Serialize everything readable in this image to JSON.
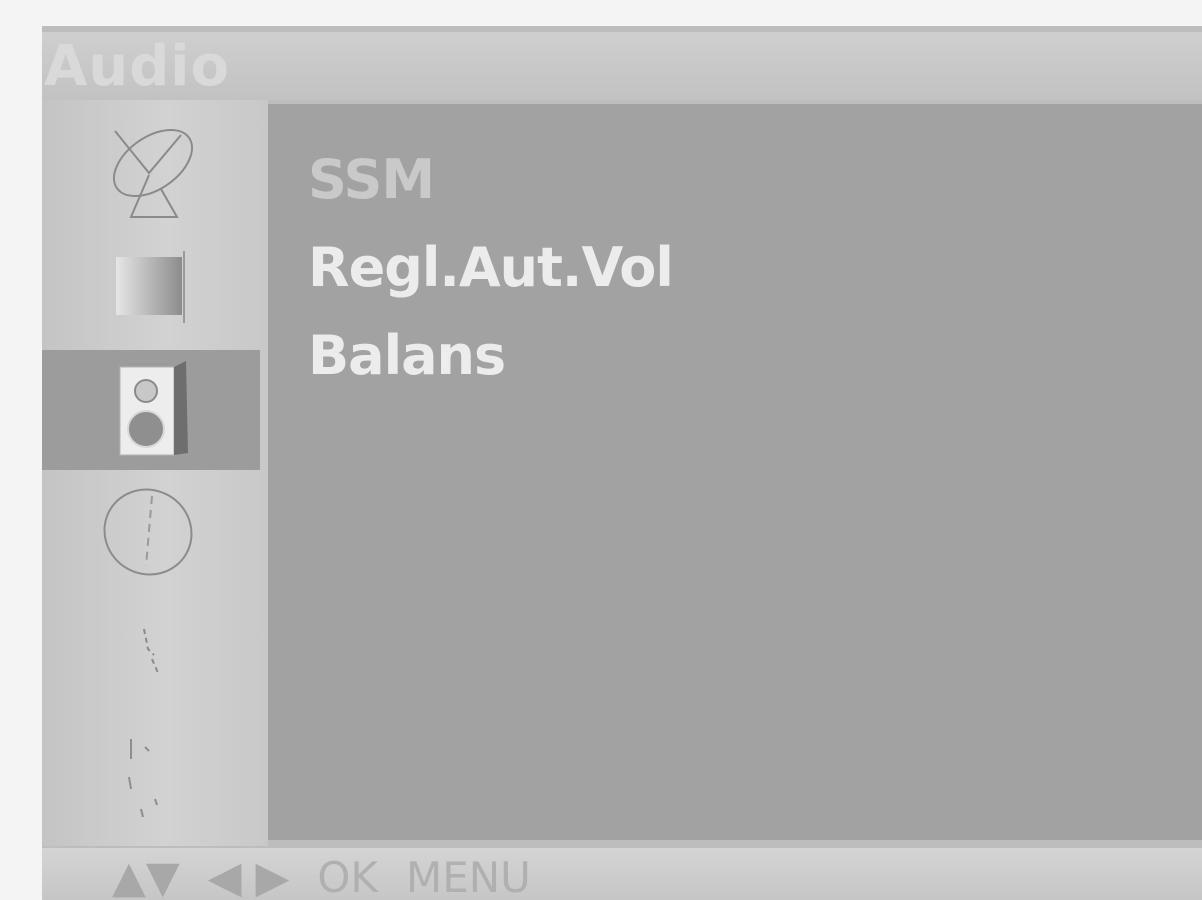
{
  "osd": {
    "title": "Audio",
    "sidebar_icons": [
      {
        "name": "satellite-dish-icon",
        "selected": false
      },
      {
        "name": "picture-icon",
        "selected": false
      },
      {
        "name": "speaker-icon",
        "selected": true
      },
      {
        "name": "clock-icon",
        "selected": false
      },
      {
        "name": "special-settings-icon",
        "selected": false
      },
      {
        "name": "screen-icon",
        "selected": false
      }
    ],
    "menu": {
      "items": [
        {
          "label": "SSM"
        },
        {
          "label": "Regl.Aut.Vol"
        },
        {
          "label": "Balans"
        }
      ]
    },
    "footer": {
      "updown_glyph": "▲▼",
      "leftright_glyph": "◀ ▶",
      "ok_label": "OK",
      "menu_label": "MENU"
    }
  },
  "colors": {
    "panel_bg": "#a2a2a2",
    "sidebar_bg": "#c4c4c4",
    "selected_bg": "#9c9c9c",
    "menu_text": "#ececec"
  }
}
